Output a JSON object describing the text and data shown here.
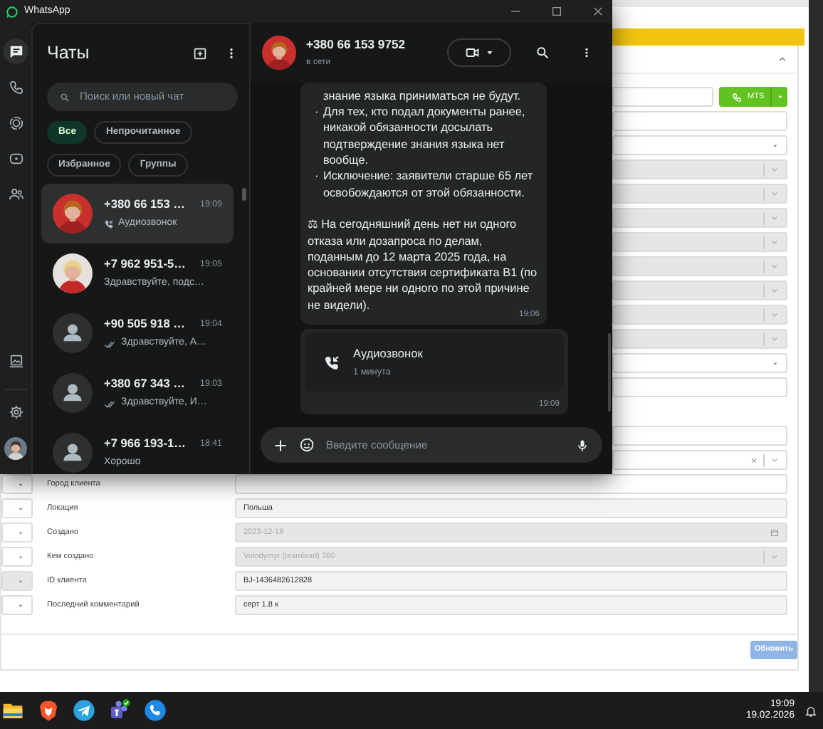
{
  "whatsapp": {
    "title": "WhatsApp",
    "rail": [
      {
        "kind": "chats",
        "selected": true
      },
      {
        "kind": "calls",
        "selected": false
      },
      {
        "kind": "status",
        "selected": false
      },
      {
        "kind": "channels",
        "selected": false
      },
      {
        "kind": "communities",
        "selected": false
      }
    ],
    "list_title": "Чаты",
    "search": {
      "placeholder": "Поиск или новый чат"
    },
    "filters": [
      {
        "label": "Все",
        "selected": true
      },
      {
        "label": "Непрочитанное",
        "selected": false
      },
      {
        "label": "Избранное",
        "selected": false
      },
      {
        "label": "Группы",
        "selected": false
      }
    ],
    "chats": [
      {
        "name": "+380 66 153 …",
        "time": "19:09",
        "preview": {
          "kind": "call",
          "text": "Аудиозвонок"
        },
        "selected": true
      },
      {
        "name": "+7 962 951-5…",
        "time": "19:05",
        "preview": {
          "kind": "text",
          "text": "Здравствуйте, подс…"
        },
        "selected": false
      },
      {
        "name": "+90 505 918 …",
        "time": "19:04",
        "preview": {
          "kind": "delivered",
          "text": "Здравствуйте, А…"
        },
        "kind": "contact",
        "selected": false
      },
      {
        "name": "+380 67 343 …",
        "time": "19:03",
        "preview": {
          "kind": "delivered",
          "text": "Здравствуйте, И…"
        },
        "kind": "contact",
        "selected": false
      },
      {
        "name": "+7 966 193-1…",
        "time": "18:41",
        "preview": {
          "kind": "text",
          "text": "Хорошо"
        },
        "kind": "contact",
        "selected": false
      }
    ],
    "conversation": {
      "name": "+380 66 153 9752",
      "status": "в сети",
      "message": {
        "blocks": [
          {
            "kind": "continuation",
            "text": "знание языка приниматься не будут."
          },
          {
            "kind": "bullet",
            "marker": "·",
            "text": "Для тех, кто подал документы ранее, никакой обязанности досылать подтверждение знания языка нет вообще."
          },
          {
            "kind": "bullet",
            "marker": "·",
            "text": "Исключение: заявители старше 65 лет освобождаются от этой обязанности."
          },
          {
            "kind": "paragraph",
            "text": "⚖ На сегодняшний день нет ни одного отказа или дозапроса по делам, поданным до 12 марта 2025 года, на основании отсутствия сертификата B1 (по крайней мере ни одного по этой причине не видели)."
          }
        ],
        "time": "19:06"
      },
      "call": {
        "title": "Аудиозвонок",
        "duration": "1 минута",
        "time": "19:09"
      },
      "composer": {
        "placeholder": "Введите сообщение"
      }
    }
  },
  "crm": {
    "rows": [
      {
        "kind": "phone",
        "button": "MTS",
        "disabled": false
      },
      {
        "kind": "input",
        "disabled": false
      },
      {
        "kind": "select",
        "disabled": false
      },
      {
        "kind": "select",
        "disabled": true
      },
      {
        "kind": "select",
        "disabled": true
      },
      {
        "kind": "select",
        "disabled": true
      },
      {
        "kind": "select",
        "disabled": true
      },
      {
        "kind": "select",
        "disabled": true
      },
      {
        "kind": "select",
        "disabled": true
      },
      {
        "kind": "select",
        "disabled": true
      },
      {
        "kind": "select",
        "disabled": true
      },
      {
        "kind": "select",
        "disabled": false
      },
      {
        "kind": "input",
        "disabled": false
      },
      {
        "kind": "spacer"
      },
      {
        "kind": "input",
        "disabled": false
      },
      {
        "kind": "select",
        "clearable": true,
        "disabled": false
      },
      {
        "kind": "input",
        "label": "Город клиента",
        "disabled": false,
        "side": {
          "disabled": false
        }
      },
      {
        "kind": "input",
        "label": "Локация",
        "value": "Польша",
        "readonly": true,
        "disabled": false,
        "side": {
          "disabled": false
        }
      },
      {
        "kind": "date",
        "label": "Создано",
        "value": "2023-12-18",
        "disabled": true,
        "side": {
          "disabled": false
        }
      },
      {
        "kind": "select",
        "label": "Кем создано",
        "value": "Volodymyr (teamlead) 360",
        "disabled": true,
        "side": {
          "disabled": false
        }
      },
      {
        "kind": "input",
        "label": "ID клиента",
        "value": "BJ-1436482612828",
        "readonly": true,
        "disabled": false,
        "side": {
          "disabled": true
        }
      },
      {
        "kind": "input",
        "label": "Последний комментарий",
        "value": "серт 1.8 к",
        "readonly": true,
        "disabled": false,
        "side": {
          "disabled": false
        }
      }
    ],
    "submit": "Обновить"
  },
  "taskbar": {
    "time": "19:09",
    "date": "19.02.2026"
  }
}
